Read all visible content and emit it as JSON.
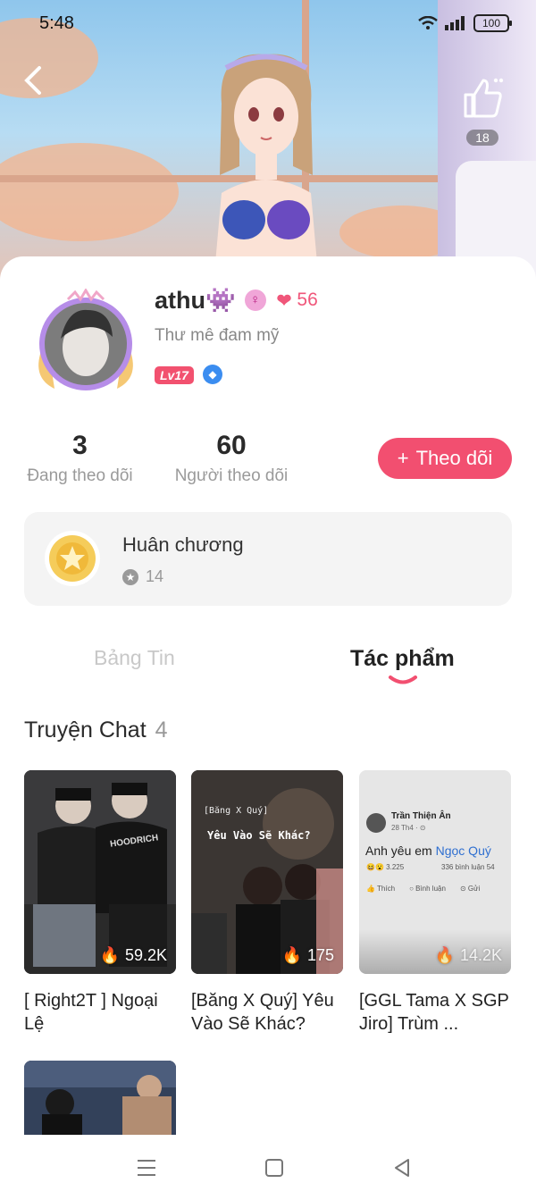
{
  "status_bar": {
    "time": "5:48",
    "battery": "100"
  },
  "hero": {
    "likes": "18"
  },
  "profile": {
    "name": "athu👾",
    "heart_count": "56",
    "bio": "Thư mê đam mỹ",
    "level": "Lv17"
  },
  "stats": [
    {
      "value": "3",
      "label": "Đang theo dõi"
    },
    {
      "value": "60",
      "label": "Người theo dõi"
    }
  ],
  "follow_button": {
    "icon": "+",
    "label": "Theo dõi"
  },
  "medal": {
    "title": "Huân chương",
    "count": "14"
  },
  "tabs": [
    {
      "label": "Bảng Tin",
      "active": false
    },
    {
      "label": "Tác phẩm",
      "active": true
    }
  ],
  "section": {
    "title": "Truyện Chat",
    "count": "4"
  },
  "stories": [
    {
      "title": "[ Right2T ] Ngoại Lệ",
      "views": "59.2K",
      "overlay_text": "HOODRICH"
    },
    {
      "title": "[Băng X Quý] Yêu Vào Sẽ Khác?",
      "views": "175",
      "overlay_tag": "[Băng X Quý]",
      "overlay_text": "Yêu Vào Sẽ Khác?"
    },
    {
      "title": "[GGL Tama X SGP Jiro] Trùm ...",
      "views": "14.2K",
      "post_author": "Trần Thiện Ân",
      "post_date": "28 Th4 · ⊙",
      "post_text_a": "Anh yêu em ",
      "post_text_b": "Ngọc Quý",
      "post_reacts": "3.225",
      "post_comments": "336 bình luận",
      "post_shares": "54",
      "post_like": "Thích",
      "post_comment": "Bình luận",
      "post_send": "Gửi"
    }
  ],
  "colors": {
    "accent": "#f24f70",
    "level_badge": "#f2516f"
  }
}
